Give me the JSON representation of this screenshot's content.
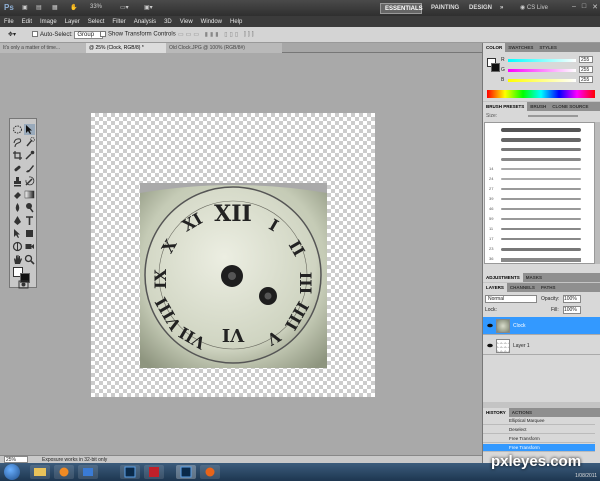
{
  "titlebar": {
    "app_icon": "Ps",
    "zoom": "33%",
    "workspaces": [
      "ESSENTIALS",
      "PAINTING",
      "DESIGN",
      "»"
    ],
    "cs_live": "CS Live"
  },
  "menu": [
    "File",
    "Edit",
    "Image",
    "Layer",
    "Select",
    "Filter",
    "Analysis",
    "3D",
    "View",
    "Window",
    "Help"
  ],
  "options": {
    "auto_select_label": "Auto-Select:",
    "auto_select_value": "Group",
    "show_transform_label": "Show Transform Controls"
  },
  "tabs": [
    "It's only a matter of time...",
    "@ 25% (Clock, RGB/8) *",
    "Old Clock.JPG @ 100% (RGB/8#)"
  ],
  "status": {
    "zoom": "25%",
    "info": "Exposure works in 32-bit only"
  },
  "color_panel": {
    "tabs": [
      "COLOR",
      "SWATCHES",
      "STYLES"
    ],
    "rows": [
      {
        "label": "R",
        "value": "255"
      },
      {
        "label": "G",
        "value": "255"
      },
      {
        "label": "B",
        "value": "255"
      }
    ]
  },
  "brush_panel": {
    "tabs": [
      "BRUSH PRESETS",
      "BRUSH",
      "CLONE SOURCE"
    ],
    "size_label": "Size:",
    "brush_numbers": [
      "",
      "",
      "",
      "",
      "14",
      "24",
      "27",
      "39",
      "46",
      "59",
      "11",
      "17",
      "23",
      "36"
    ]
  },
  "adjust_tabs": [
    "ADJUSTMENTS",
    "MASKS"
  ],
  "layers_panel": {
    "tabs": [
      "LAYERS",
      "CHANNELS",
      "PATHS"
    ],
    "blend_mode": "Normal",
    "opacity_label": "Opacity:",
    "opacity": "100%",
    "lock_label": "Lock:",
    "fill_label": "Fill:",
    "fill": "100%",
    "layers": [
      {
        "name": "Clock",
        "selected": true
      },
      {
        "name": "Layer 1",
        "selected": false
      }
    ]
  },
  "history_panel": {
    "tabs": [
      "HISTORY",
      "ACTIONS"
    ],
    "items": [
      {
        "name": "Elliptical Marquee",
        "selected": false
      },
      {
        "name": "Deselect",
        "selected": false
      },
      {
        "name": "Free Transform",
        "selected": false
      },
      {
        "name": "Free Transform",
        "selected": true
      }
    ]
  },
  "watermark": "pxleyes.com",
  "tray_date": "1/08/2011",
  "colors": {
    "selection": "#3399ff",
    "ui_dark": "#3b3b3b",
    "panel": "#d8d8d8"
  }
}
